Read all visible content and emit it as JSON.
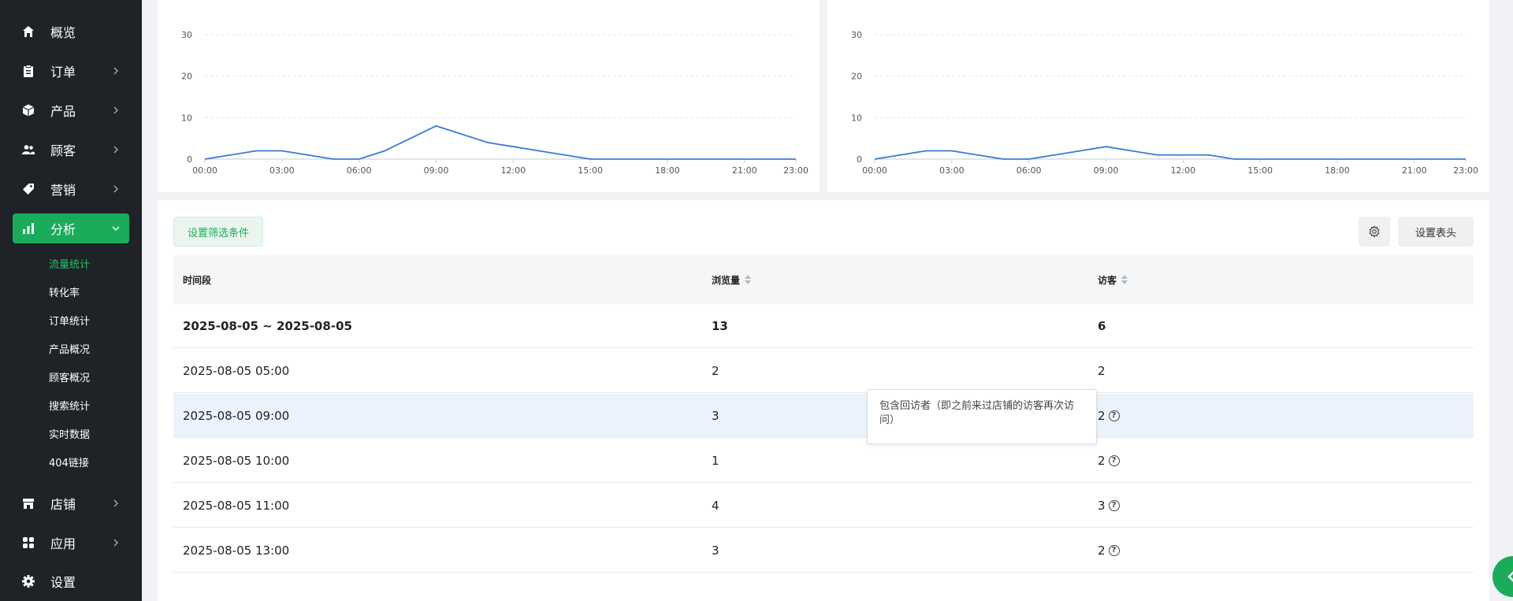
{
  "sidebar": {
    "items": [
      {
        "label": "概览",
        "icon": "home-icon"
      },
      {
        "label": "订单",
        "icon": "clipboard-icon"
      },
      {
        "label": "产品",
        "icon": "box-icon"
      },
      {
        "label": "顾客",
        "icon": "users-icon"
      },
      {
        "label": "营销",
        "icon": "tag-icon"
      },
      {
        "label": "分析",
        "icon": "bar-chart-icon"
      },
      {
        "label": "店铺",
        "icon": "store-icon"
      },
      {
        "label": "应用",
        "icon": "apps-icon"
      },
      {
        "label": "设置",
        "icon": "gear-icon"
      }
    ],
    "sub_items": [
      "流量统计",
      "转化率",
      "订单统计",
      "产品概况",
      "顾客概况",
      "搜索统计",
      "实时数据",
      "404链接"
    ],
    "active_color": "#1aac5b"
  },
  "chart_data": [
    {
      "type": "line",
      "title": "",
      "x": [
        "00:00",
        "01:00",
        "02:00",
        "03:00",
        "04:00",
        "05:00",
        "06:00",
        "07:00",
        "08:00",
        "09:00",
        "10:00",
        "11:00",
        "12:00",
        "13:00",
        "14:00",
        "15:00",
        "16:00",
        "17:00",
        "18:00",
        "19:00",
        "20:00",
        "21:00",
        "22:00",
        "23:00"
      ],
      "xticks": [
        "00:00",
        "03:00",
        "06:00",
        "09:00",
        "12:00",
        "15:00",
        "18:00",
        "21:00",
        "23:00"
      ],
      "series": [
        {
          "values": [
            0,
            1,
            2,
            2,
            1,
            0,
            0,
            2,
            5,
            8,
            6,
            4,
            3,
            2,
            1,
            0,
            0,
            0,
            0,
            0,
            0,
            0,
            0,
            0
          ]
        }
      ],
      "yticks": [
        0,
        10,
        20,
        30
      ],
      "ylim": [
        0,
        30
      ],
      "grid": true,
      "color": "#3a7bd5"
    },
    {
      "type": "line",
      "title": "",
      "x": [
        "00:00",
        "01:00",
        "02:00",
        "03:00",
        "04:00",
        "05:00",
        "06:00",
        "07:00",
        "08:00",
        "09:00",
        "10:00",
        "11:00",
        "12:00",
        "13:00",
        "14:00",
        "15:00",
        "16:00",
        "17:00",
        "18:00",
        "19:00",
        "20:00",
        "21:00",
        "22:00",
        "23:00"
      ],
      "xticks": [
        "00:00",
        "03:00",
        "06:00",
        "09:00",
        "12:00",
        "15:00",
        "18:00",
        "21:00",
        "23:00"
      ],
      "series": [
        {
          "values": [
            0,
            1,
            2,
            2,
            1,
            0,
            0,
            1,
            2,
            3,
            2,
            1,
            1,
            1,
            0,
            0,
            0,
            0,
            0,
            0,
            0,
            0,
            0,
            0
          ]
        }
      ],
      "yticks": [
        0,
        10,
        20,
        30
      ],
      "ylim": [
        0,
        30
      ],
      "grid": true,
      "color": "#3a7bd5"
    }
  ],
  "toolbar": {
    "filter_label": "设置筛选条件",
    "header_label": "设置表头"
  },
  "table": {
    "columns": [
      "时间段",
      "浏览量",
      "访客"
    ],
    "summary": {
      "period": "2025-08-05 ~ 2025-08-05",
      "views": "13",
      "visitors": "6"
    },
    "rows": [
      {
        "period": "2025-08-05 05:00",
        "views": "2",
        "visitors": "2"
      },
      {
        "period": "2025-08-05 09:00",
        "views": "3",
        "visitors": "2"
      },
      {
        "period": "2025-08-05 10:00",
        "views": "1",
        "visitors": "2"
      },
      {
        "period": "2025-08-05 11:00",
        "views": "4",
        "visitors": "3"
      },
      {
        "period": "2025-08-05 13:00",
        "views": "3",
        "visitors": "2"
      }
    ]
  },
  "tooltip": {
    "text": "包含回访者（即之前来过店铺的访客再次访问）"
  }
}
